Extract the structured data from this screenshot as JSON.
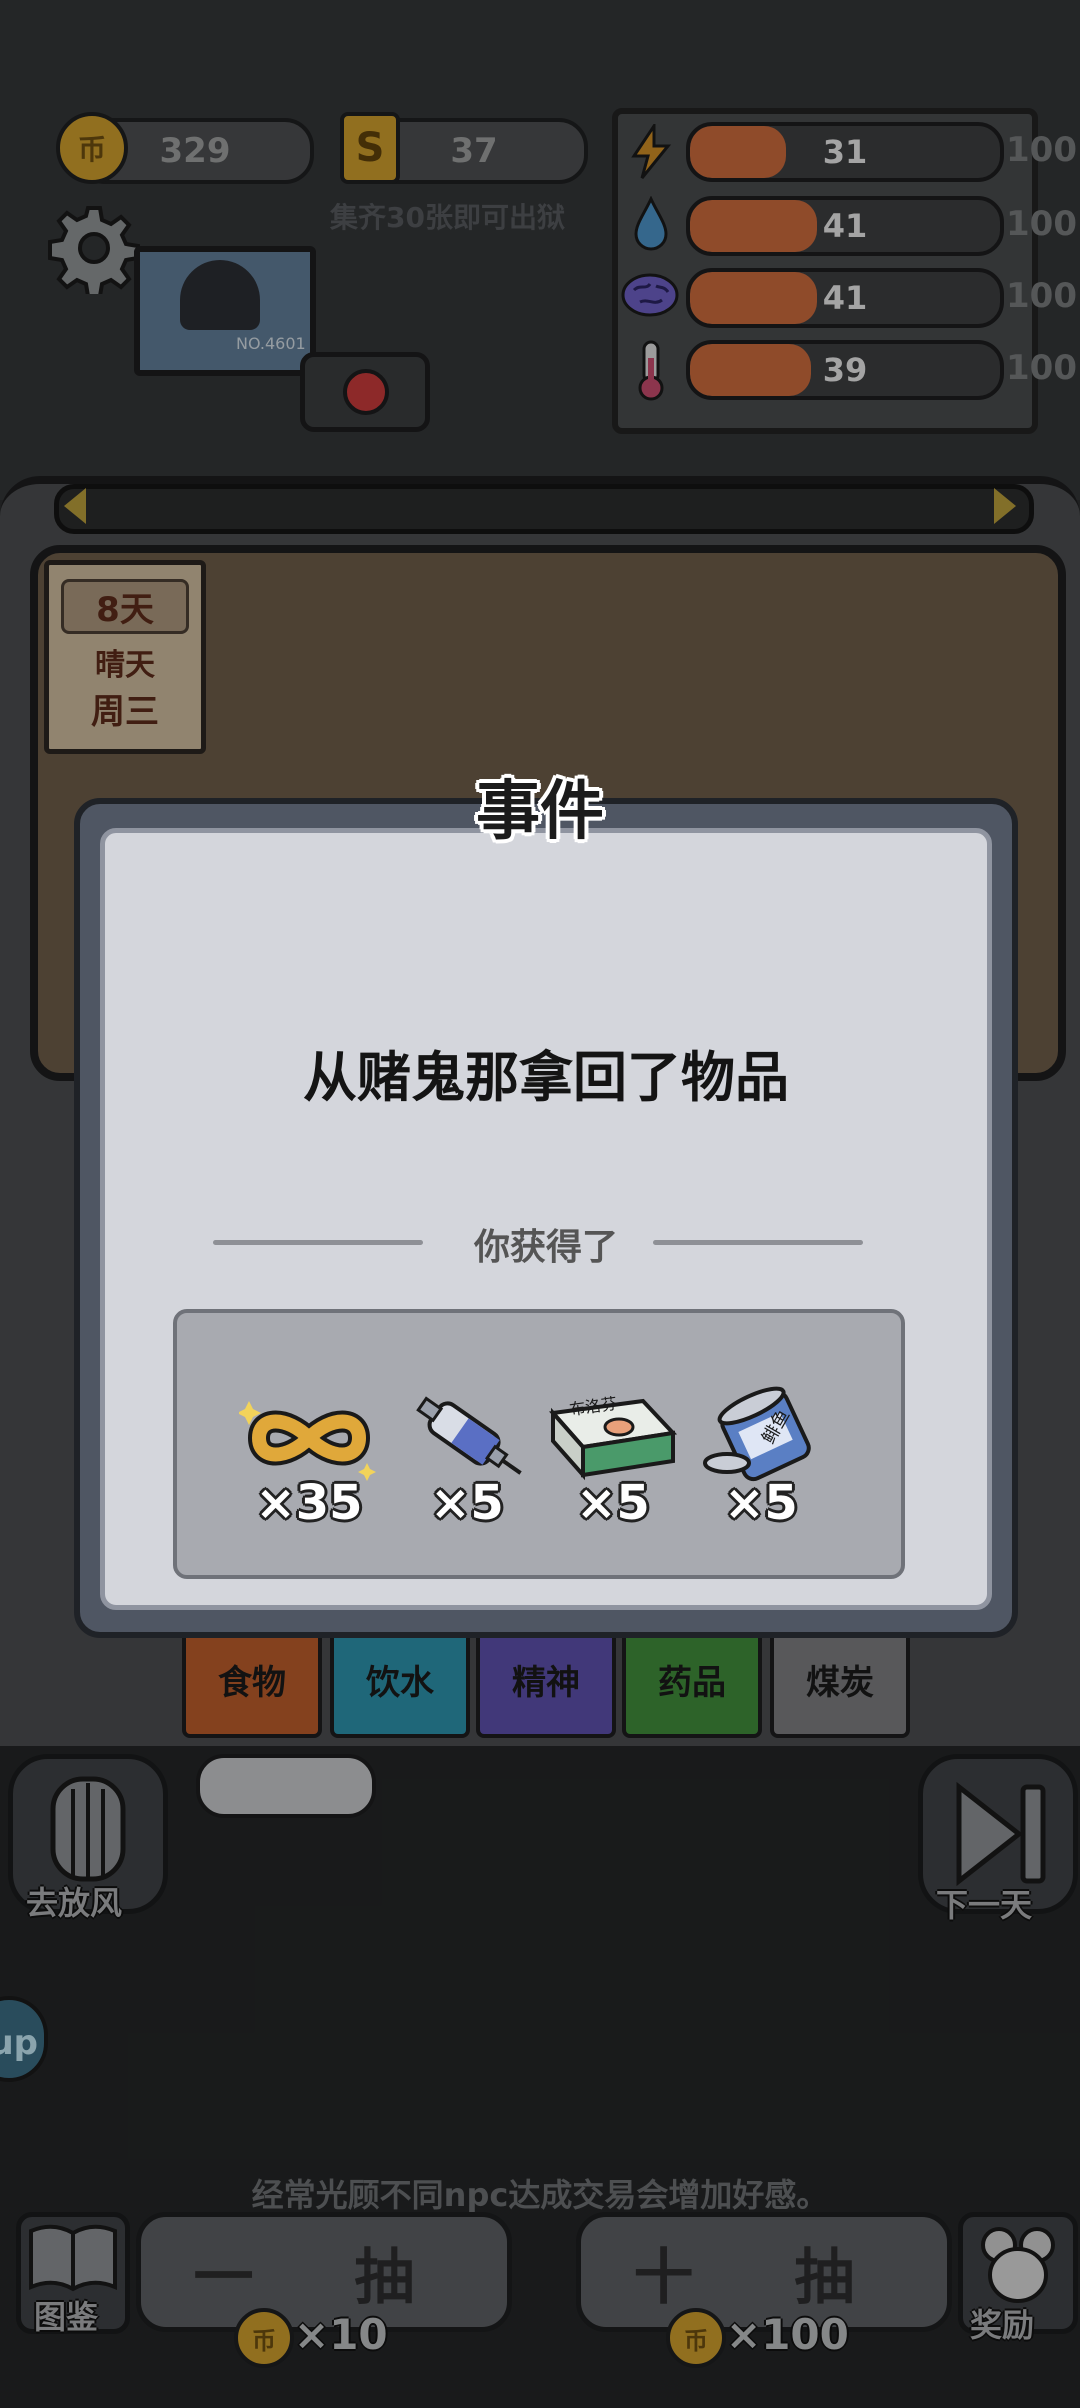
{
  "hud": {
    "coins": "329",
    "coin_symbol": "币",
    "s_cards": "37",
    "s_symbol": "S",
    "collect_hint": "集齐30张即可出狱",
    "prisoner_tag": "NO.4601",
    "stats": [
      {
        "icon": "lightning-icon",
        "value": "31",
        "max": "100",
        "fill": 0.31
      },
      {
        "icon": "water-drop-icon",
        "value": "41",
        "max": "100",
        "fill": 0.41
      },
      {
        "icon": "brain-icon",
        "value": "41",
        "max": "100",
        "fill": 0.41
      },
      {
        "icon": "thermometer-icon",
        "value": "39",
        "max": "100",
        "fill": 0.39
      }
    ]
  },
  "calendar": {
    "days": "8天",
    "weather": "晴天",
    "weekday": "周三"
  },
  "categories": [
    {
      "label": "食物",
      "color": "#b85a2a"
    },
    {
      "label": "饮水",
      "color": "#2b8fa8"
    },
    {
      "label": "精神",
      "color": "#5a4ea8"
    },
    {
      "label": "药品",
      "color": "#3f8a3a"
    },
    {
      "label": "煤炭",
      "color": "#7a7b7d"
    }
  ],
  "dialog": {
    "title": "事件",
    "message": "从赌鬼那拿回了物品",
    "gain_label": "你获得了",
    "rewards": [
      {
        "icon": "infinity-token-icon",
        "qty": "×35"
      },
      {
        "icon": "syringe-icon",
        "qty": "×5"
      },
      {
        "icon": "medicine-box-icon",
        "qty": "×5"
      },
      {
        "icon": "canned-food-icon",
        "qty": "×5"
      }
    ],
    "medicine_label": "布洛芬",
    "can_label": "鲱鱼"
  },
  "bottom": {
    "go_out_label": "去放风",
    "next_day_label": "下一天",
    "tip": "经常光顾不同npc达成交易会增加好感。",
    "collection_label": "图鉴",
    "reward_label": "奖励",
    "draw_one_label": "一 抽",
    "draw_ten_label": "十 抽",
    "draw_one_cost": "×10",
    "draw_ten_cost": "×100",
    "side_tab": "up"
  }
}
